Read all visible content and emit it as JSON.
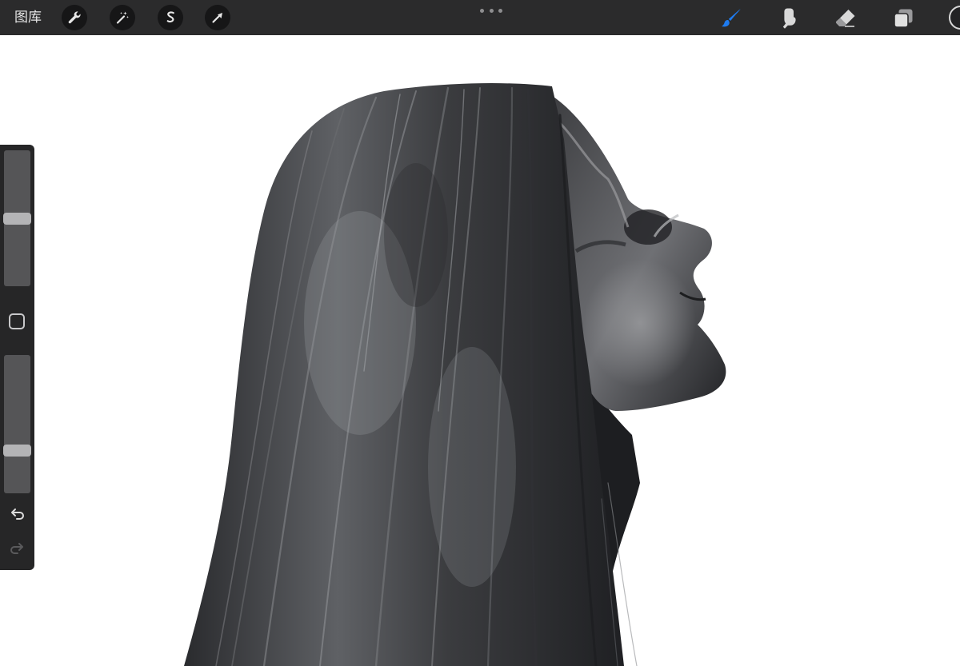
{
  "toolbar": {
    "gallery_label": "图库",
    "left_tools": [
      {
        "name": "actions",
        "icon": "wrench-icon"
      },
      {
        "name": "adjustments",
        "icon": "magic-wand-icon"
      },
      {
        "name": "selection",
        "icon": "selection-s-icon"
      },
      {
        "name": "transform",
        "icon": "arrow-cursor-icon"
      }
    ],
    "more_icon": "more-dots-icon",
    "right_tools": [
      {
        "name": "brush",
        "icon": "brush-icon",
        "active": true
      },
      {
        "name": "smudge",
        "icon": "smudge-finger-icon",
        "active": false
      },
      {
        "name": "eraser",
        "icon": "eraser-icon",
        "active": false
      },
      {
        "name": "layers",
        "icon": "layers-icon",
        "active": false
      }
    ],
    "accent_color": "#1e7bf0",
    "current_color": "#232325"
  },
  "sidebar": {
    "brush_size_level": 0.5,
    "brush_opacity_level": 0.29,
    "modify_icon": "square-modify-icon",
    "undo_icon": "undo-icon",
    "redo_icon": "redo-icon",
    "redo_enabled": false
  },
  "canvas": {
    "background": "#ffffff",
    "hair_color": "#2f3033",
    "hair_light": "#86888c",
    "skin_shadow": "#1f2022",
    "skin_light": "#8a8b8e"
  }
}
